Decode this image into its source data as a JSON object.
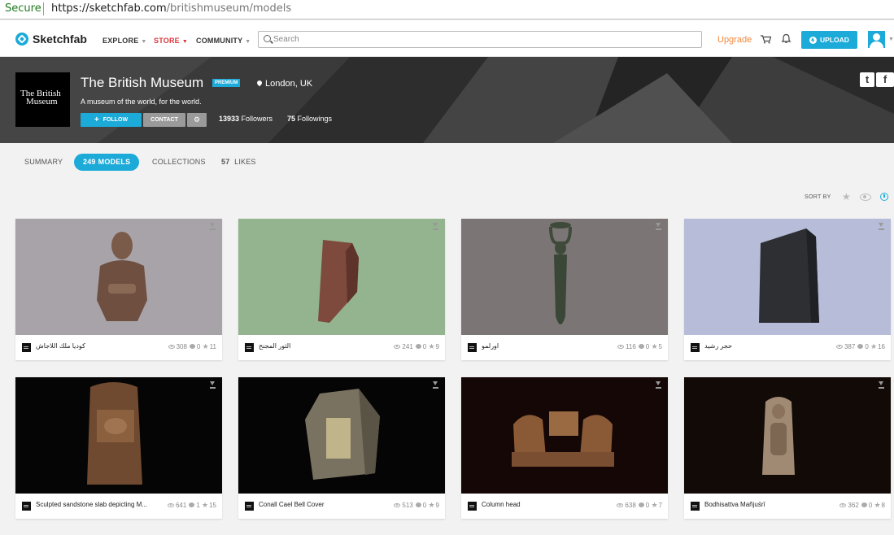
{
  "browser": {
    "secure_label": "Secure",
    "url_host": "https://sketchfab.com",
    "url_path": "/britishmuseum/models"
  },
  "nav": {
    "brand": "Sketchfab",
    "explore": "EXPLORE",
    "store": "STORE",
    "community": "COMMUNITY",
    "search_placeholder": "Search",
    "upgrade": "Upgrade",
    "upload": "UPLOAD"
  },
  "profile": {
    "logo_line1": "The British",
    "logo_line2": "Museum",
    "name": "The British Museum",
    "badge": "PREMIUM",
    "location": "London, UK",
    "tagline": "A museum of the world, for the world.",
    "follow": "FOLLOW",
    "contact": "CONTACT",
    "followers_count": "13933",
    "followers_label": "Followers",
    "followings_count": "75",
    "followings_label": "Followings"
  },
  "tabs": {
    "summary": "SUMMARY",
    "models_count": "249",
    "models_label": "MODELS",
    "collections": "COLLECTIONS",
    "likes_count": "57",
    "likes_label": "LIKES"
  },
  "sort_label": "SORT BY",
  "colors": {
    "accent": "#1caad9",
    "store": "#d9373c",
    "upgrade": "#f0883e",
    "banner": "#3a3a3a"
  },
  "models": [
    {
      "title": "كوديا ملك اللاجاش",
      "views": "308",
      "comments": "0",
      "likes": "11",
      "bg": "#a8a3a8"
    },
    {
      "title": "الثور المجنح",
      "views": "241",
      "comments": "0",
      "likes": "9",
      "bg": "#93b48e"
    },
    {
      "title": "اورلمو",
      "views": "116",
      "comments": "0",
      "likes": "5",
      "bg": "#7b7675"
    },
    {
      "title": "حجر رشيد",
      "views": "387",
      "comments": "0",
      "likes": "16",
      "bg": "#b7bcd8"
    },
    {
      "title": "Sculpted sandstone slab depicting M...",
      "views": "641",
      "comments": "1",
      "likes": "15",
      "bg": "#050505"
    },
    {
      "title": "Conall Cael Bell Cover",
      "views": "513",
      "comments": "0",
      "likes": "9",
      "bg": "#050505"
    },
    {
      "title": "Column head",
      "views": "638",
      "comments": "0",
      "likes": "7",
      "bg": "#140706"
    },
    {
      "title": "Bodhisattva Mañjuśrī",
      "views": "362",
      "comments": "0",
      "likes": "8",
      "bg": "#120a07"
    }
  ]
}
